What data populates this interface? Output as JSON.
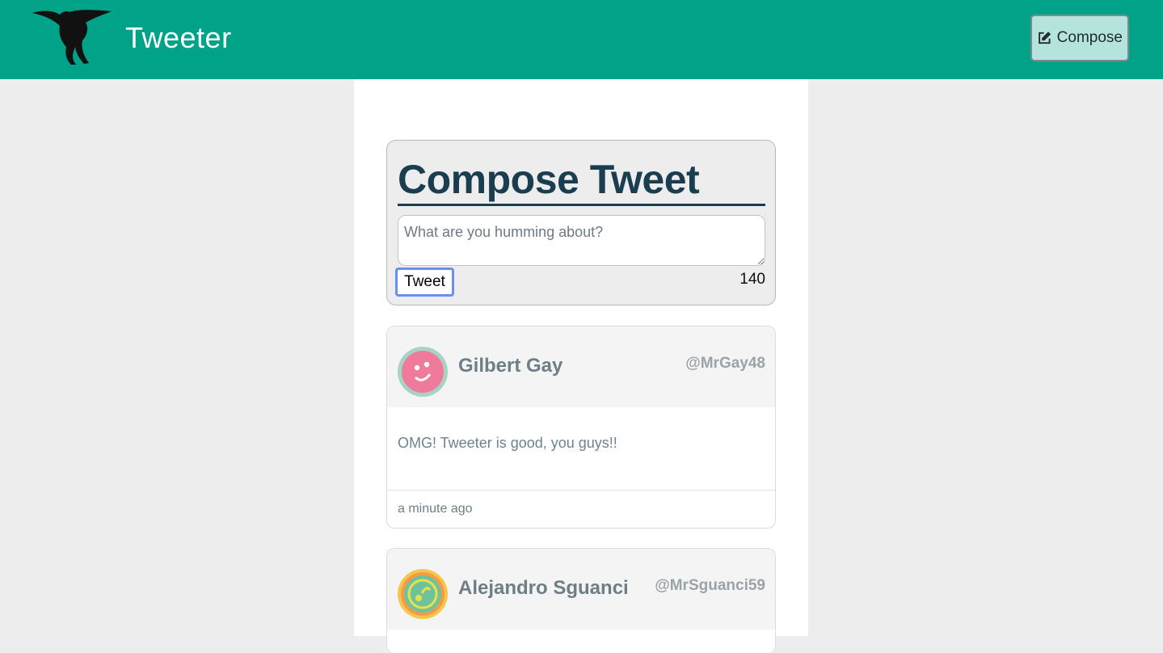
{
  "nav": {
    "brand": "Tweeter",
    "logo_icon": "hummingbird-logo",
    "compose_label": "Compose",
    "compose_icon": "edit-icon"
  },
  "compose": {
    "title": "Compose Tweet",
    "placeholder": "What are you humming about?",
    "submit_label": "Tweet",
    "counter": "140"
  },
  "tweets": [
    {
      "name": "Gilbert Gay",
      "handle": "@MrGay48",
      "text": "OMG! Tweeter is good, you guys!!",
      "time": "a minute ago",
      "avatar_color": "#f07a9c",
      "avatar_ring": "#a6d3c4"
    },
    {
      "name": "Alejandro Sguanci",
      "handle": "@MrSguanci59",
      "avatar_color": "#6ec39a",
      "avatar_ring": "#f5c748"
    }
  ],
  "colors": {
    "accent": "#00a387",
    "compose_btn_bg": "#b5e3dd",
    "title": "#1a3d4f",
    "page_bg": "#ededed"
  }
}
